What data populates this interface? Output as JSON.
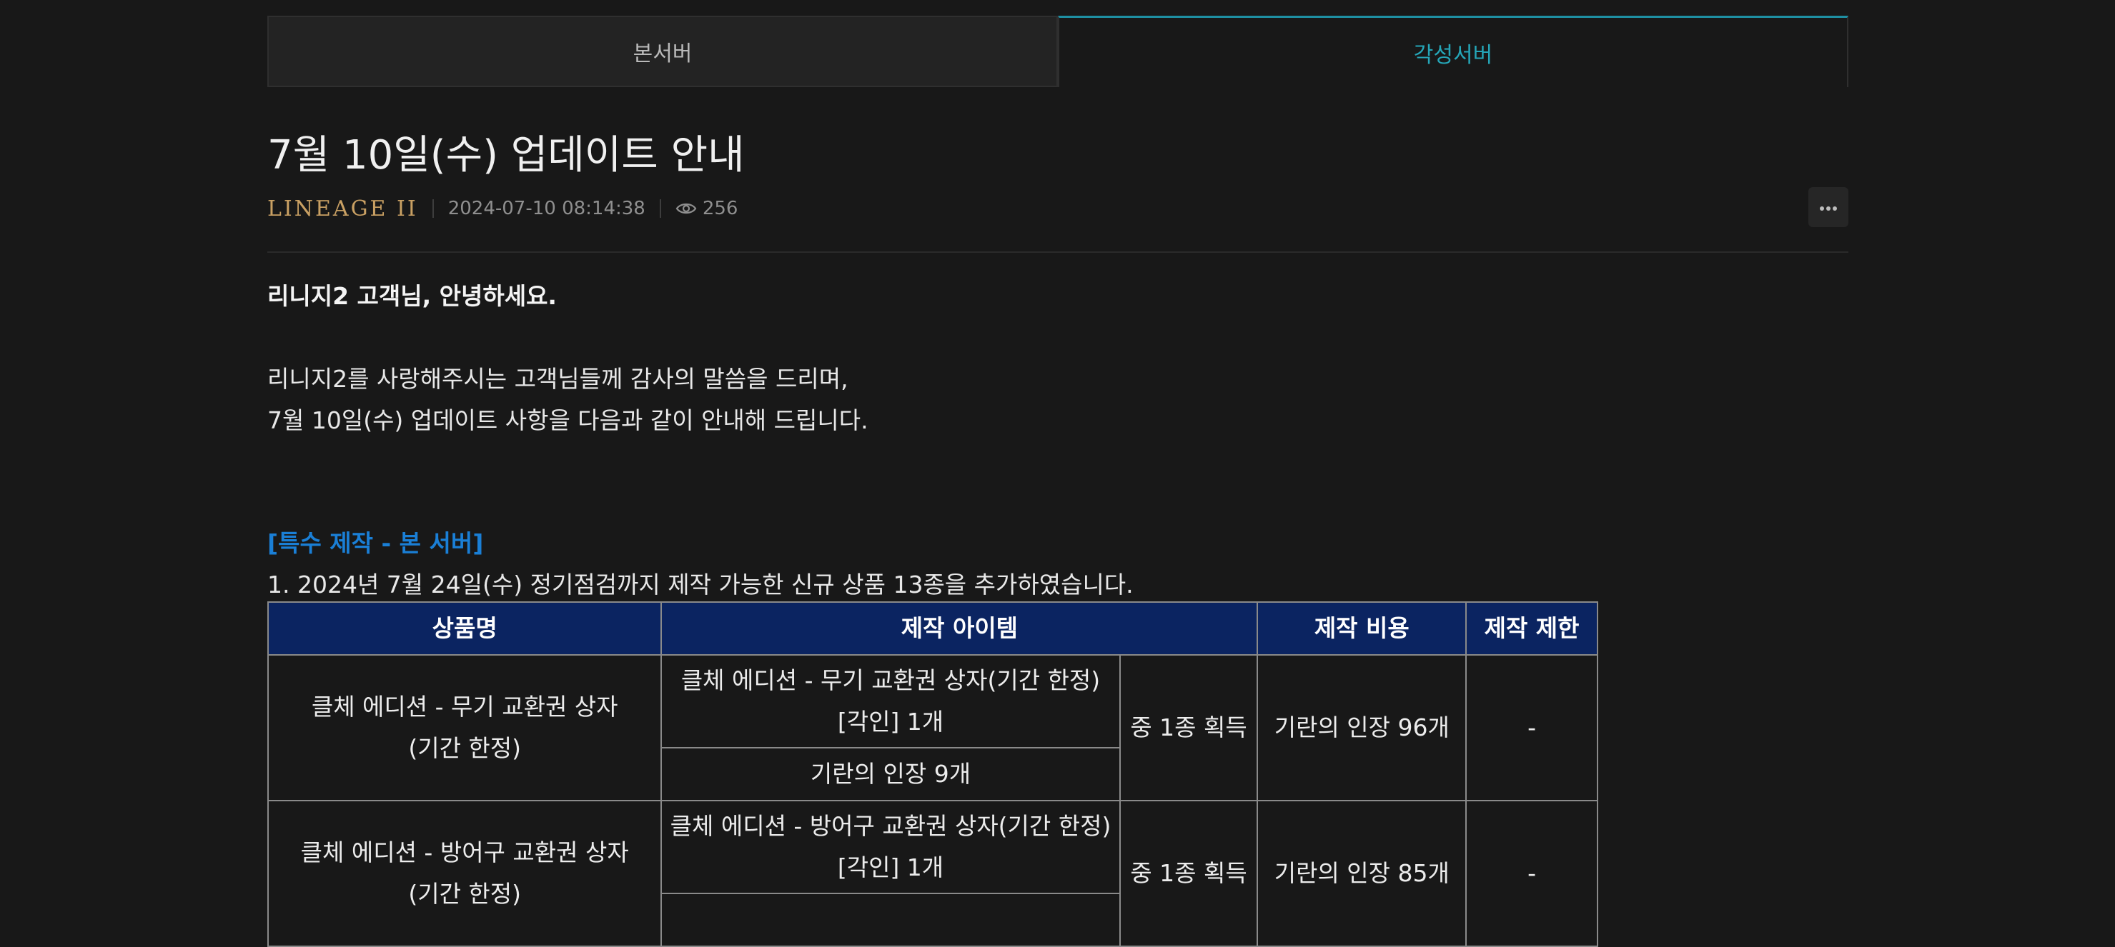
{
  "tabs": [
    {
      "label": "본서버",
      "active": false
    },
    {
      "label": "각성서버",
      "active": true
    }
  ],
  "post": {
    "title": "7월 10일(수) 업데이트 안내",
    "author_logo": "LINEAGE II",
    "datetime": "2024-07-10 08:14:38",
    "views": "256"
  },
  "content": {
    "greeting": "리니지2 고객님, 안녕하세요.",
    "intro_line1": "리니지2를 사랑해주시는 고객님들께 감사의 말씀을 드리며,",
    "intro_line2": "7월 10일(수) 업데이트 사항을 다음과 같이 안내해 드립니다.",
    "section_title": "[특수 제작 - 본 서버]",
    "item1": "1. 2024년 7월 24일(수) 정기점검까지 제작 가능한 신규 상품 13종을 추가하였습니다."
  },
  "table": {
    "headers": [
      "상품명",
      "제작 아이템",
      "제작 비용",
      "제작 제한"
    ],
    "rows": [
      {
        "product_line1": "클체 에디션 - 무기 교환권 상자",
        "product_line2": "(기간 한정)",
        "material1_line1": "클체 에디션 - 무기 교환권 상자(기간 한정)",
        "material1_line2": "[각인] 1개",
        "material2": "기란의 인장 9개",
        "result": "중 1종 획득",
        "cost": "기란의 인장 96개",
        "limit": "-"
      },
      {
        "product_line1": "클체 에디션 - 방어구 교환권 상자",
        "product_line2": "(기간 한정)",
        "material1_line1": "클체 에디션 - 방어구 교환권 상자(기간 한정)",
        "material1_line2": "[각인] 1개",
        "material2": "",
        "result": "중 1종 획득",
        "cost": "기란의 인장 85개",
        "limit": "-"
      }
    ]
  },
  "colors": {
    "background": "#181818",
    "accent_tab": "#25a6b8",
    "section_title": "#1a7fd6",
    "table_header": "#0b2461",
    "logo_gold": "#c9a063"
  }
}
